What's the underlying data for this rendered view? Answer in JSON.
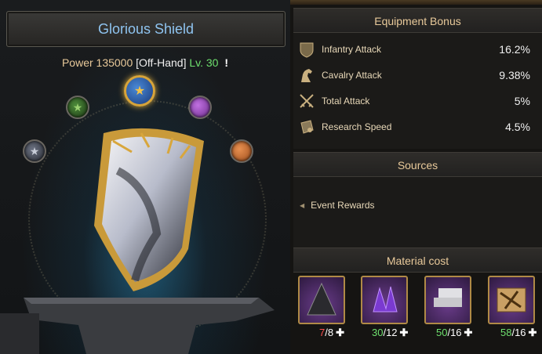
{
  "header": {
    "title": "Glorious Shield"
  },
  "item": {
    "power_label": "Power",
    "power": "135000",
    "slot": "[Off-Hand]",
    "level": "Lv. 30",
    "info": "!"
  },
  "gems": [
    {
      "name": "blue-star-gem",
      "color": "#3a6fc0",
      "selected": true
    },
    {
      "name": "green-star-gem",
      "color": "#3f7a2e"
    },
    {
      "name": "grey-star-gem",
      "color": "#5a6070"
    },
    {
      "name": "purple-gem",
      "color": "#b060d8"
    },
    {
      "name": "orange-gem",
      "color": "#d87a3a"
    }
  ],
  "equipment_bonus": {
    "title": "Equipment Bonus",
    "rows": [
      {
        "icon": "shield-icon",
        "label": "Infantry Attack",
        "value": "16.2%"
      },
      {
        "icon": "horse-icon",
        "label": "Cavalry Attack",
        "value": "9.38%"
      },
      {
        "icon": "crossed-swords-icon",
        "label": "Total Attack",
        "value": "5%"
      },
      {
        "icon": "scroll-icon",
        "label": "Research Speed",
        "value": "4.5%"
      }
    ]
  },
  "sources": {
    "title": "Sources",
    "items": [
      "Event Rewards"
    ]
  },
  "material_cost": {
    "title": "Material cost",
    "items": [
      {
        "icon": "black-ore-icon",
        "have": "7",
        "need": "/8"
      },
      {
        "icon": "purple-crystal-icon",
        "have": "30",
        "need": "/12"
      },
      {
        "icon": "silver-ingot-icon",
        "have": "50",
        "need": "/16"
      },
      {
        "icon": "gold-cloth-icon",
        "have": "58",
        "need": "/16"
      }
    ]
  },
  "colors": {
    "accent": "#e8c99a",
    "title_blue": "#8fc4f0",
    "level_green": "#6ee06e",
    "lacking_red": "#ff5050",
    "frame_gold": "#b08a46"
  }
}
